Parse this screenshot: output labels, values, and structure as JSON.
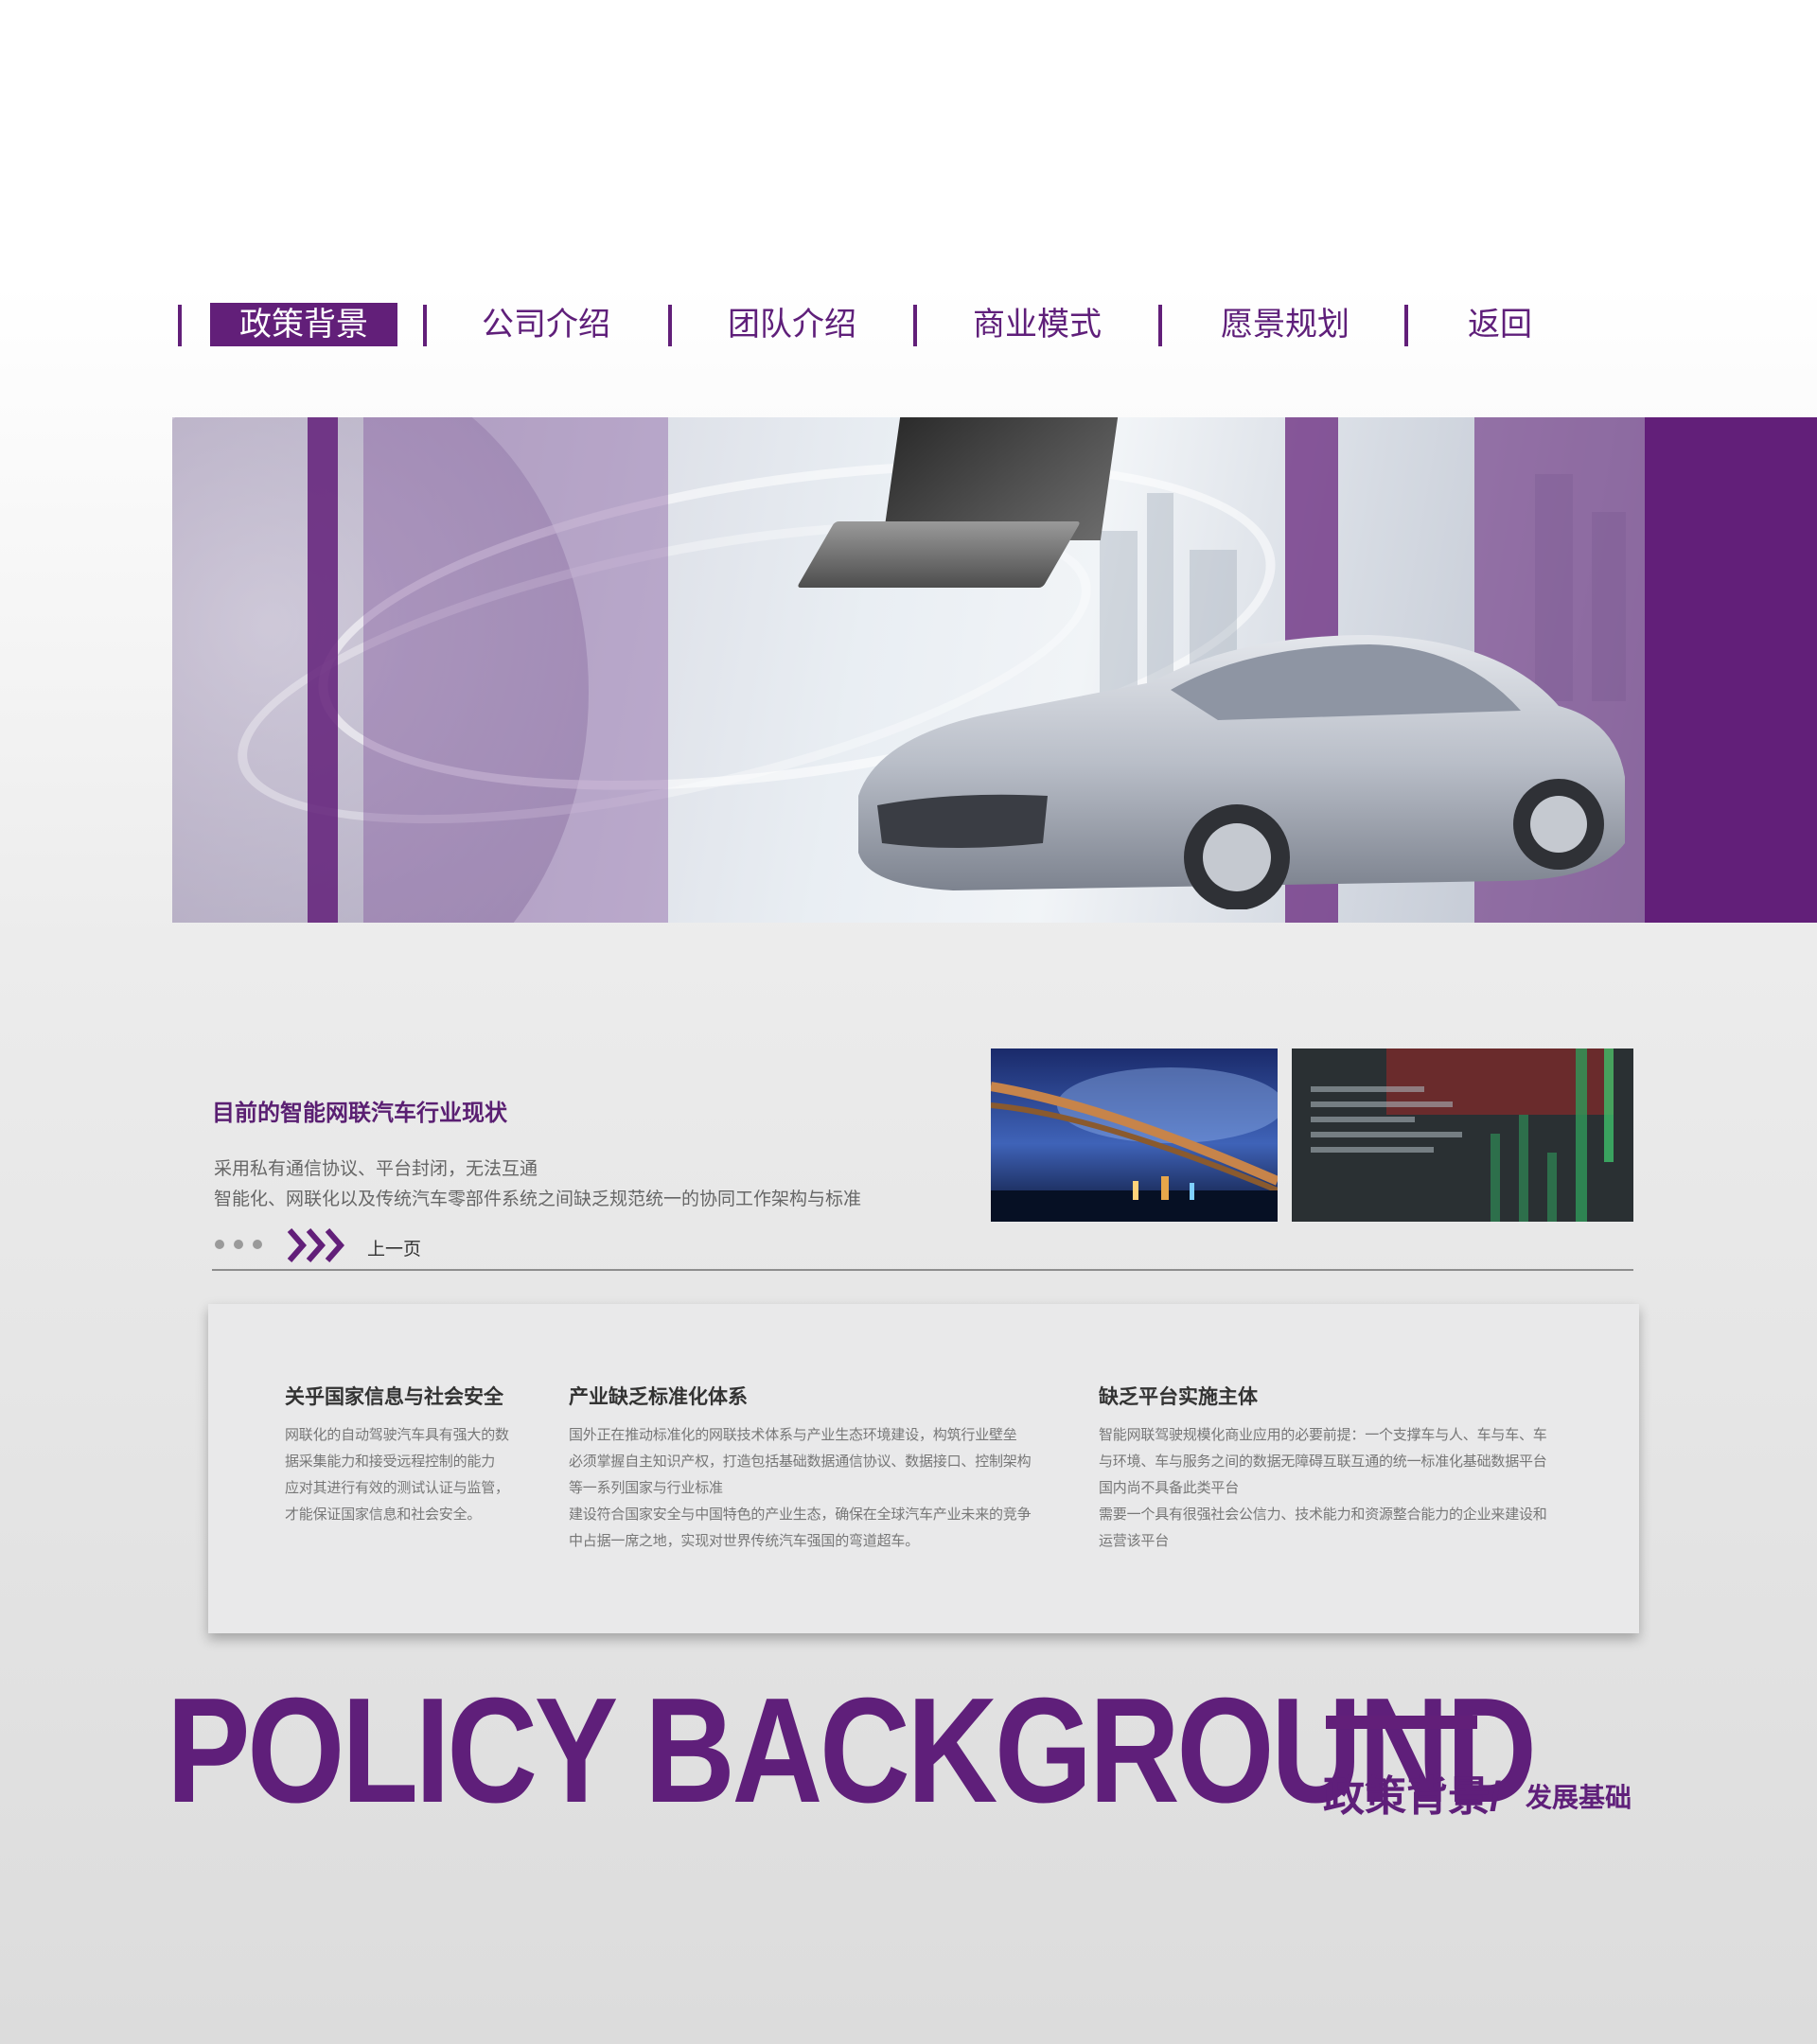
{
  "nav": {
    "items": [
      {
        "label": "政策背景",
        "active": true
      },
      {
        "label": "公司介绍",
        "active": false
      },
      {
        "label": "团队介绍",
        "active": false
      },
      {
        "label": "商业模式",
        "active": false
      },
      {
        "label": "愿景规划",
        "active": false
      },
      {
        "label": "返回",
        "active": false
      }
    ]
  },
  "status": {
    "title": "目前的智能网联汽车行业现状",
    "line1": "采用私有通信协议、平台封闭，无法互通",
    "line2": "智能化、网联化以及传统汽车零部件系统之间缺乏规范统一的协同工作架构与标准",
    "prev_label": "上一页"
  },
  "card": {
    "col1": {
      "title": "关乎国家信息与社会安全",
      "lines": [
        "网联化的自动驾驶汽车具有强大的数",
        "据采集能力和接受远程控制的能力",
        "应对其进行有效的测试认证与监管，",
        "才能保证国家信息和社会安全。"
      ]
    },
    "col2": {
      "title": "产业缺乏标准化体系",
      "lines": [
        "国外正在推动标准化的网联技术体系与产业生态环境建设，构筑行业壁垒",
        "必须掌握自主知识产权，打造包括基础数据通信协议、数据接口、控制架构",
        "等一系列国家与行业标准",
        "建设符合国家安全与中国特色的产业生态，确保在全球汽车产业未来的竞争",
        "中占据一席之地，实现对世界传统汽车强国的弯道超车。"
      ]
    },
    "col3": {
      "title": "缺乏平台实施主体",
      "lines": [
        "智能网联驾驶规模化商业应用的必要前提：一个支撑车与人、车与车、车",
        "与环境、车与服务之间的数据无障碍互联互通的统一标准化基础数据平台",
        "国内尚不具备此类平台",
        "需要一个具有很强社会公信力、技术能力和资源整合能力的企业来建设和",
        "运营该平台"
      ]
    }
  },
  "footer": {
    "big_title": "POLICY BACKGROUND",
    "sub_cn": "政策背景/",
    "sub_cn2": "发展基础"
  },
  "colors": {
    "brand_purple": "#621f79",
    "text_gray": "#777777"
  },
  "icons": [
    "chevron-right-icon",
    "pagination-dots-icon"
  ]
}
